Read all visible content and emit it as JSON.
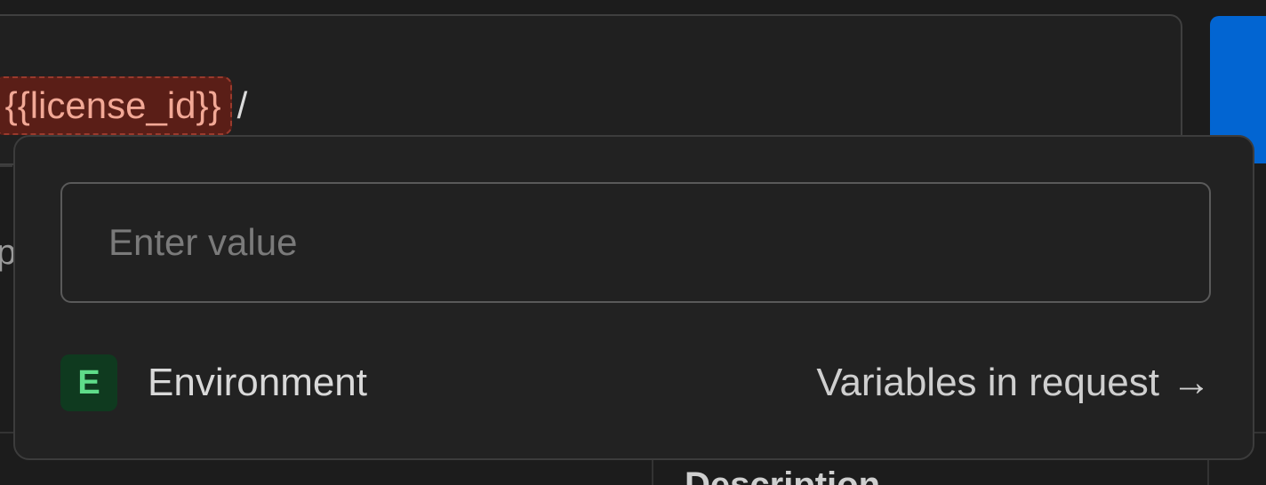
{
  "url_bar": {
    "slash_before": "/",
    "variable": "{{license_id}}",
    "slash_after": "/"
  },
  "background": {
    "left_fragment": "p",
    "column_header_fragment": "Description"
  },
  "popover": {
    "value_input": {
      "placeholder": "Enter value",
      "value": ""
    },
    "scope": {
      "badge": "E",
      "label": "Environment"
    },
    "link": {
      "label": "Variables in request",
      "icon": "arrow-right-icon",
      "arrow": "→"
    }
  },
  "colors": {
    "accent": "#0265d2",
    "variable_chip_bg": "#5a1e17",
    "variable_chip_text": "#f2a896",
    "environment_badge_bg": "#0f3a1f",
    "environment_badge_text": "#5fdc8a"
  }
}
